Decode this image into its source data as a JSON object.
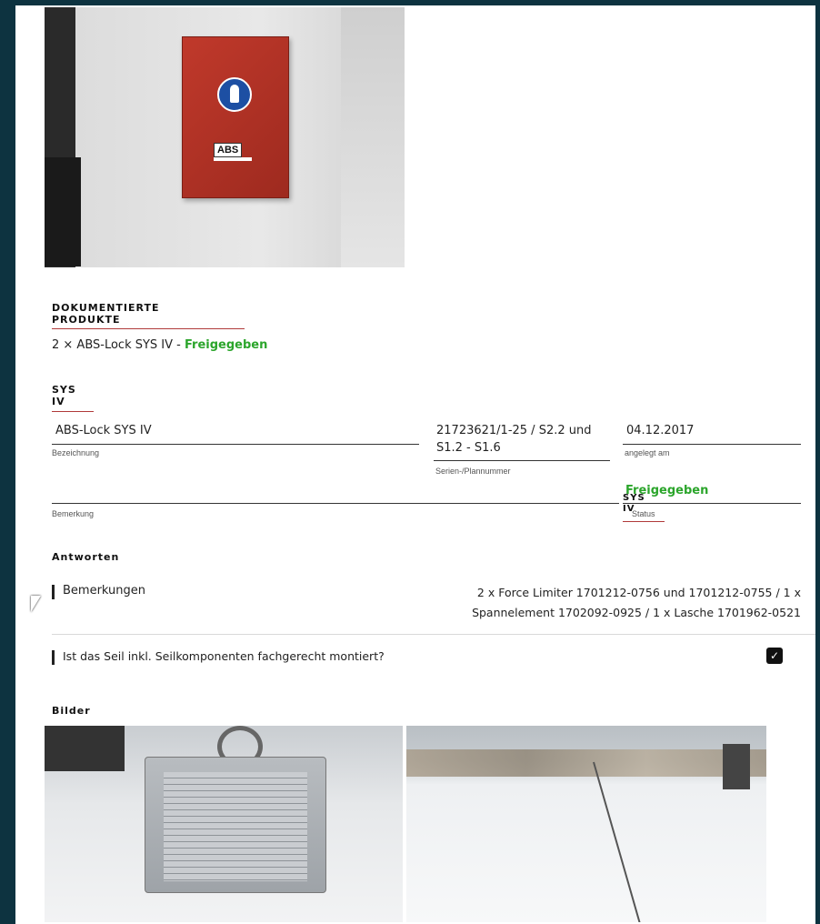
{
  "documented": {
    "heading_line1": "DOKUMENTIERTE",
    "heading_line2": "PRODUKTE",
    "summary_prefix": "2 × ABS-Lock SYS IV - ",
    "summary_status": "Freigegeben"
  },
  "product": {
    "heading_line1": "SYS",
    "heading_line2": "IV",
    "name_value": "ABS-Lock SYS IV",
    "name_label": "Bezeichnung",
    "serial_value_line1": "21723621/1-25 / S2.2 und",
    "serial_value_line2": "S1.2 - S1.6",
    "serial_label": "Serien-/Plannummer",
    "date_value": "04.12.2017",
    "date_label": "angelegt am",
    "remark_label": "Bemerkung",
    "status_value": "Freigegeben",
    "status_overlay_line1": "SYS",
    "status_overlay_line2": "IV",
    "status_label": "Status"
  },
  "answers": {
    "heading": "Antworten",
    "items": [
      {
        "question": "Bemerkungen",
        "answer_line1": "2 x Force Limiter 1701212-0756 und 1701212-0755 / 1 x",
        "answer_line2": "Spannelement 1702092-0925 / 1 x Lasche 1701962-0521"
      },
      {
        "question": "Ist das Seil inkl. Seilkomponenten fachgerecht montiert?",
        "answer_checked": true,
        "check_icon": "checkmark"
      }
    ]
  },
  "images": {
    "heading": "Bilder",
    "top_photo_text": "ABS"
  },
  "colors": {
    "background": "#0d3340",
    "status_green": "#2ba52b",
    "heading_underline": "#b03a3a"
  }
}
